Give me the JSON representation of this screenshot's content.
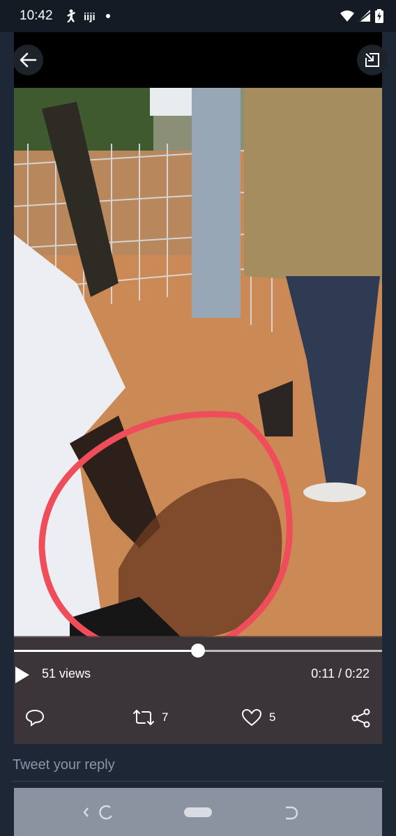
{
  "status_bar": {
    "time": "10:42",
    "icons_left": [
      "fighter-app-icon",
      "jiji-app-icon",
      "dot-icon"
    ],
    "icons_right": [
      "wifi-icon",
      "signal-icon",
      "battery-charging-icon"
    ]
  },
  "video": {
    "views": "51 views",
    "time": "0:11 / 0:22",
    "progress": 0.5,
    "annotation": "red hand-drawn circle"
  },
  "actions": {
    "reply_icon": "comment-icon",
    "retweet_icon": "retweet-icon",
    "retweet_count": "7",
    "like_icon": "heart-icon",
    "like_count": "5",
    "share_icon": "share-icon"
  },
  "reply": {
    "placeholder": "Tweet your reply"
  },
  "colors": {
    "background": "#1e2735",
    "annotation": "#f04d5b"
  }
}
